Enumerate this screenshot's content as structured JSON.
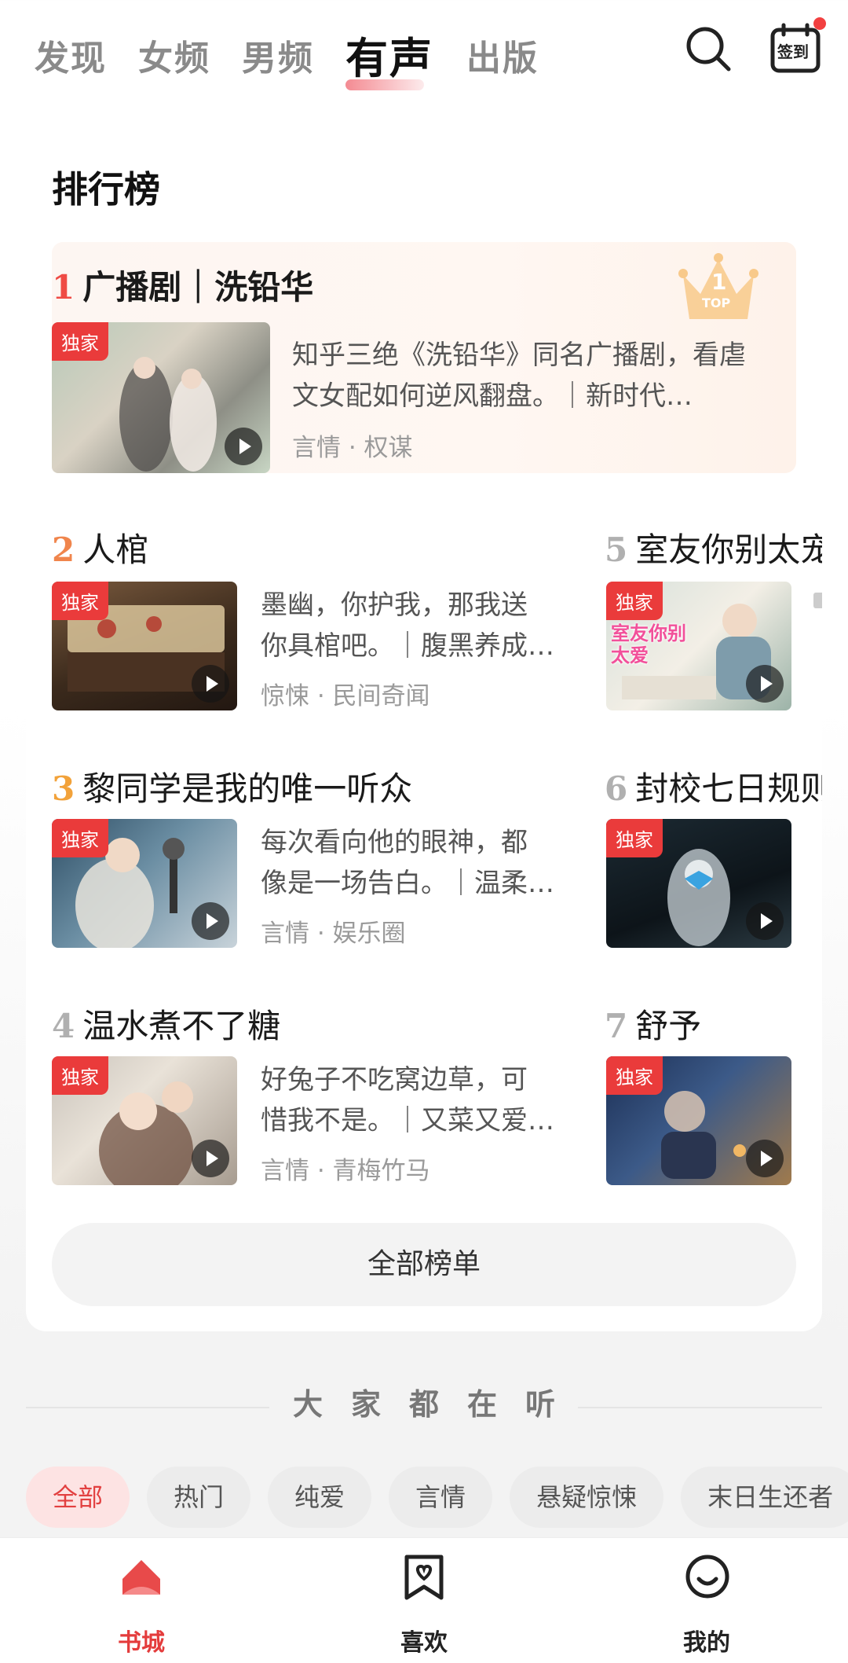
{
  "topnav": {
    "tabs": [
      {
        "label": "发现"
      },
      {
        "label": "女频"
      },
      {
        "label": "男频"
      },
      {
        "label": "有声"
      },
      {
        "label": "出版"
      }
    ],
    "active_tab": "有声",
    "checkin_label": "签到"
  },
  "rank": {
    "title": "排行榜",
    "crown_label": "TOP",
    "crown_number": "1",
    "items": [
      {
        "rank": "1",
        "title": "广播剧｜洗铅华",
        "desc": "知乎三绝《洗铅华》同名广播剧，看虐文女配如何逆风翻盘。｜新时代…",
        "meta": "言情 · 权谋",
        "tag": "独家"
      },
      {
        "rank": "2",
        "title": "人棺",
        "desc_line1": "墨幽，你护我，那我送",
        "desc_line2": "你具棺吧。｜腹黑养成…",
        "meta": "惊悚 · 民间奇闻",
        "tag": "独家"
      },
      {
        "rank": "3",
        "title": "黎同学是我的唯一听众",
        "desc_line1": "每次看向他的眼神，都",
        "desc_line2": "像是一场告白。｜温柔…",
        "meta": "言情 · 娱乐圈",
        "tag": "独家"
      },
      {
        "rank": "4",
        "title": "温水煮不了糖",
        "desc_line1": "好兔子不吃窝边草，可",
        "desc_line2": "惜我不是。｜又菜又爱…",
        "meta": "言情 · 青梅竹马",
        "tag": "独家"
      },
      {
        "rank": "5",
        "title": "室友你别太宠",
        "tag": "独家",
        "cover_text": "室友你别太爱"
      },
      {
        "rank": "6",
        "title": "封校七日规则",
        "tag": "独家"
      },
      {
        "rank": "7",
        "title": "舒予",
        "tag": "独家"
      }
    ],
    "all_button": "全部榜单"
  },
  "listening": {
    "title": "大家都在听",
    "chips": [
      "全部",
      "热门",
      "纯爱",
      "言情",
      "悬疑惊悚",
      "末日生还者"
    ],
    "active_chip": "全部"
  },
  "bottomnav": {
    "items": [
      {
        "label": "书城"
      },
      {
        "label": "喜欢"
      },
      {
        "label": "我的"
      }
    ],
    "active": "书城"
  },
  "colors": {
    "accent": "#e43c3c",
    "tag_bg": "#ea3b3b",
    "rank1": "#ef4b45",
    "rank2": "#f0854c",
    "rank3": "#f2a23a",
    "rank_other": "#b0b0b0"
  }
}
